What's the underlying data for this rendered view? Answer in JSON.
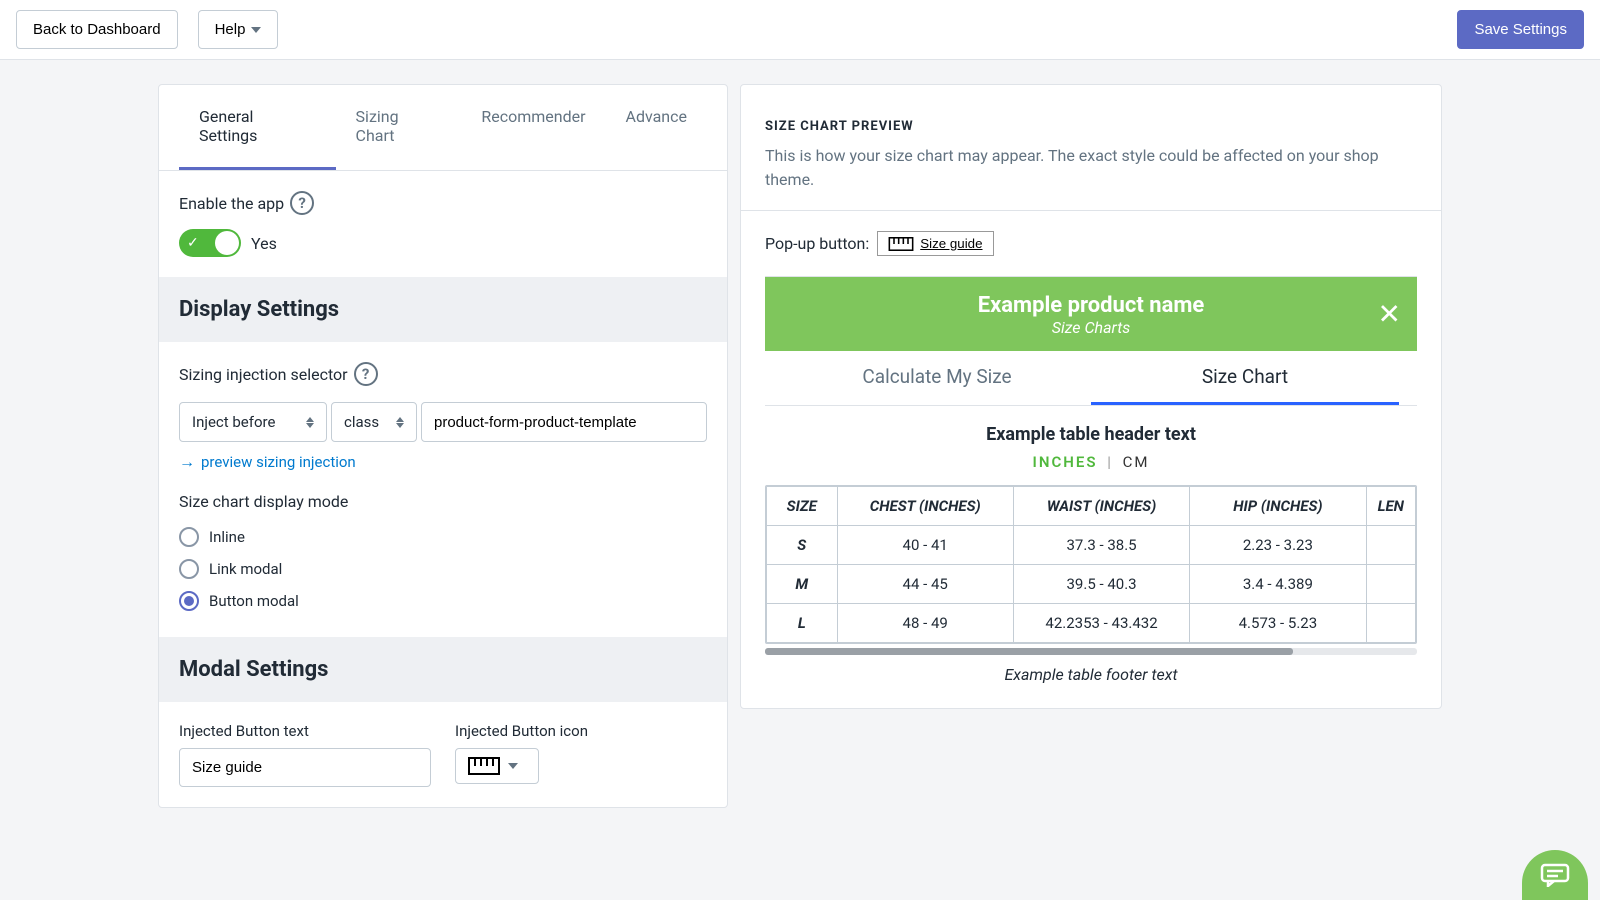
{
  "topbar": {
    "back_label": "Back to Dashboard",
    "help_label": "Help",
    "save_label": "Save Settings"
  },
  "tabs": [
    {
      "label": "General Settings",
      "active": true
    },
    {
      "label": "Sizing Chart",
      "active": false
    },
    {
      "label": "Recommender",
      "active": false
    },
    {
      "label": "Advance",
      "active": false
    }
  ],
  "general": {
    "enable_label": "Enable the app",
    "enable_value": "Yes"
  },
  "display": {
    "heading": "Display Settings",
    "injection_label": "Sizing injection selector",
    "inject_before": "Inject before",
    "class_select": "class",
    "selector_value": "product-form-product-template",
    "preview_link": "preview sizing injection",
    "mode_label": "Size chart display mode",
    "modes": [
      "Inline",
      "Link modal",
      "Button modal"
    ],
    "mode_selected": "Button modal"
  },
  "modal": {
    "heading": "Modal Settings",
    "button_text_label": "Injected Button text",
    "button_text_value": "Size guide",
    "button_icon_label": "Injected Button icon"
  },
  "preview": {
    "title": "SIZE CHART PREVIEW",
    "description": "This is how your size chart may appear. The exact style could be affected on your shop theme.",
    "popup_label": "Pop-up button:",
    "popup_button_text": "Size guide",
    "product_name": "Example product name",
    "product_sub": "Size Charts",
    "tabs": {
      "calc": "Calculate My Size",
      "chart": "Size Chart"
    },
    "table_header": "Example table header text",
    "units": {
      "active": "INCHES",
      "other": "CM"
    },
    "columns": [
      "SIZE",
      "CHEST (INCHES)",
      "WAIST (INCHES)",
      "HIP (INCHES)",
      "LEN"
    ],
    "rows": [
      {
        "size": "S",
        "chest": "40 - 41",
        "waist": "37.3 - 38.5",
        "hip": "2.23 - 3.23"
      },
      {
        "size": "M",
        "chest": "44 - 45",
        "waist": "39.5 - 40.3",
        "hip": "3.4 - 4.389"
      },
      {
        "size": "L",
        "chest": "48 - 49",
        "waist": "42.2353 - 43.432",
        "hip": "4.573 - 5.23"
      }
    ],
    "footer": "Example table footer text"
  },
  "chart_data": {
    "type": "table",
    "title": "Example table header text",
    "unit": "INCHES",
    "columns": [
      "SIZE",
      "CHEST (INCHES)",
      "WAIST (INCHES)",
      "HIP (INCHES)"
    ],
    "rows": [
      [
        "S",
        "40 - 41",
        "37.3 - 38.5",
        "2.23 - 3.23"
      ],
      [
        "M",
        "44 - 45",
        "39.5 - 40.3",
        "3.4 - 4.389"
      ],
      [
        "L",
        "48 - 49",
        "42.2353 - 43.432",
        "4.573 - 5.23"
      ]
    ]
  }
}
